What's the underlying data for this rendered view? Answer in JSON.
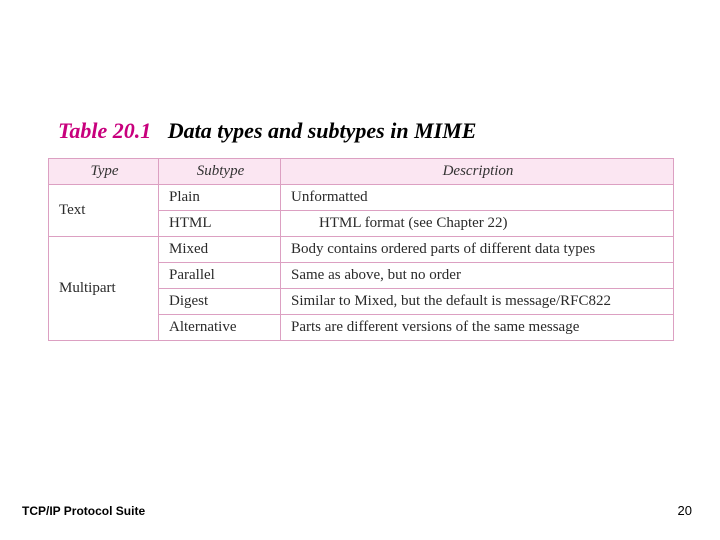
{
  "caption": {
    "number": "Table 20.1",
    "title": "Data types and subtypes in MIME"
  },
  "headers": {
    "type": "Type",
    "subtype": "Subtype",
    "description": "Description"
  },
  "rows": {
    "text": {
      "label": "Text",
      "plain": {
        "subtype": "Plain",
        "desc": "Unformatted"
      },
      "html": {
        "subtype": "HTML",
        "desc": "HTML format (see Chapter 22)"
      }
    },
    "multipart": {
      "label": "Multipart",
      "mixed": {
        "subtype": "Mixed",
        "desc": "Body contains ordered parts of different data types"
      },
      "parallel": {
        "subtype": "Parallel",
        "desc": "Same as above, but no order"
      },
      "digest": {
        "subtype": "Digest",
        "desc": "Similar to Mixed, but the default is message/RFC822"
      },
      "alternative": {
        "subtype": "Alternative",
        "desc": "Parts are different versions of the same message"
      }
    }
  },
  "footer": {
    "left": "TCP/IP Protocol Suite",
    "page": "20"
  }
}
